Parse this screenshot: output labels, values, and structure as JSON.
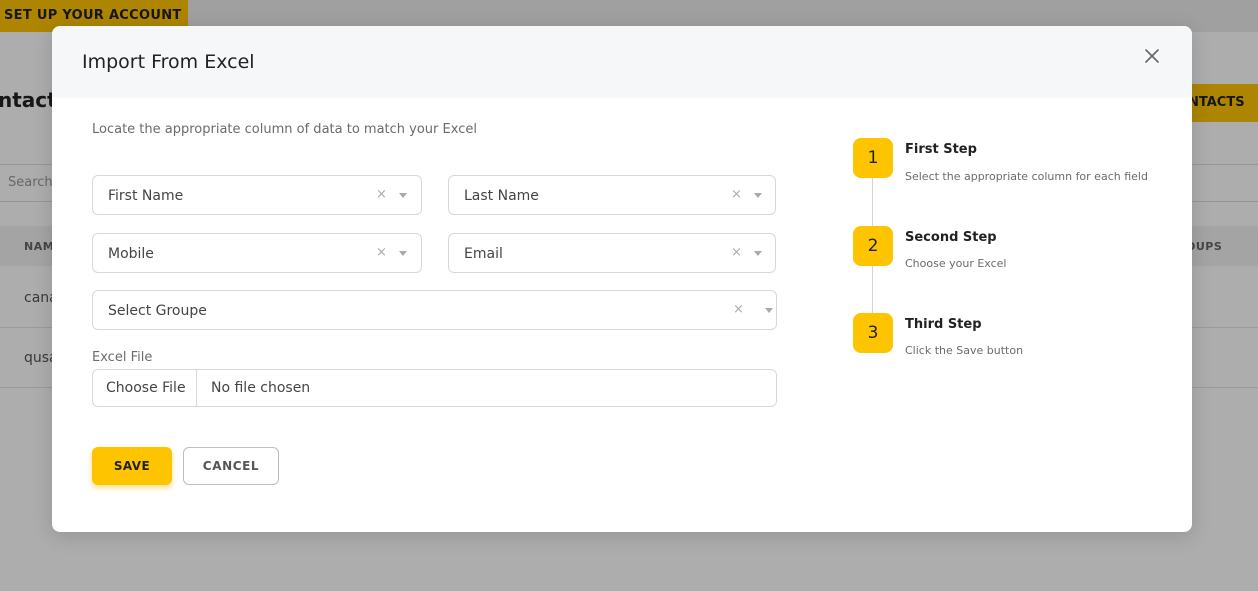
{
  "background": {
    "setup_button": "SET UP YOUR ACCOUNT",
    "page_title": "ntacts",
    "contacts_button": "NTACTS",
    "search_placeholder": "Search",
    "columns": [
      "NAM",
      "OUPS"
    ],
    "rows": [
      "cana",
      "qusa"
    ]
  },
  "modal": {
    "title": "Import From Excel",
    "close_icon": "close-icon",
    "intro": "Locate the appropriate column of data to match your Excel",
    "fields": {
      "first_name": "First Name",
      "last_name": "Last Name",
      "mobile": "Mobile",
      "email": "Email",
      "group": "Select Groupe"
    },
    "clear_glyph": "×",
    "excel_file_label": "Excel File",
    "choose_file_button": "Choose File",
    "file_status": "No file chosen",
    "save_button": "SAVE",
    "cancel_button": "CANCEL"
  },
  "steps": [
    {
      "number": "1",
      "title": "First Step",
      "description": "Select the appropriate column for each field"
    },
    {
      "number": "2",
      "title": "Second Step",
      "description": "Choose your Excel"
    },
    {
      "number": "3",
      "title": "Third Step",
      "description": "Click the Save button"
    }
  ],
  "colors": {
    "accent": "#ffc400",
    "overlay": "rgba(0,0,0,0.32)",
    "modal_header": "#f6f7f9"
  }
}
